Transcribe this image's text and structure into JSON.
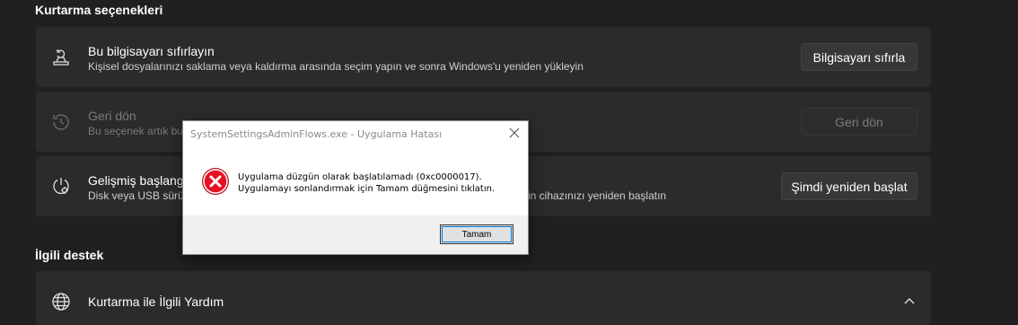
{
  "recovery": {
    "section_title": "Kurtarma seçenekleri",
    "reset": {
      "icon": "reset-pc-icon",
      "title": "Bu bilgisayarı sıfırlayın",
      "description": "Kişisel dosyalarınızı saklama veya kaldırma arasında seçim yapın ve sonra Windows'u yeniden yükleyin",
      "button": "Bilgisayarı sıfırla"
    },
    "go_back": {
      "icon": "history-icon",
      "title": "Geri dön",
      "description": "Bu seçenek artık bu",
      "button": "Geri dön"
    },
    "advanced": {
      "icon": "advanced-startup-icon",
      "title": "Gelişmiş başlangı",
      "description": "Disk veya USB sürü",
      "description_tail": "in cihazınızı yeniden başlatın",
      "button": "Şimdi yeniden başlat"
    }
  },
  "related": {
    "section_title": "İlgili destek",
    "help_item": {
      "icon": "globe-icon",
      "label": "Kurtarma ile İlgili Yardım",
      "chevron": "chevron-up-icon"
    }
  },
  "dialog": {
    "title": "SystemSettingsAdminFlows.exe - Uygulama Hatası",
    "icon": "error-icon",
    "message_line1": "Uygulama düzgün olarak başlatılamadı (0xc0000017).",
    "message_line2": "Uygulamayı sonlandırmak için Tamam düğmesini tıklatın.",
    "ok_button": "Tamam"
  },
  "colors": {
    "background": "#202020",
    "card": "#2b2b2b",
    "error_red": "#e81123"
  }
}
